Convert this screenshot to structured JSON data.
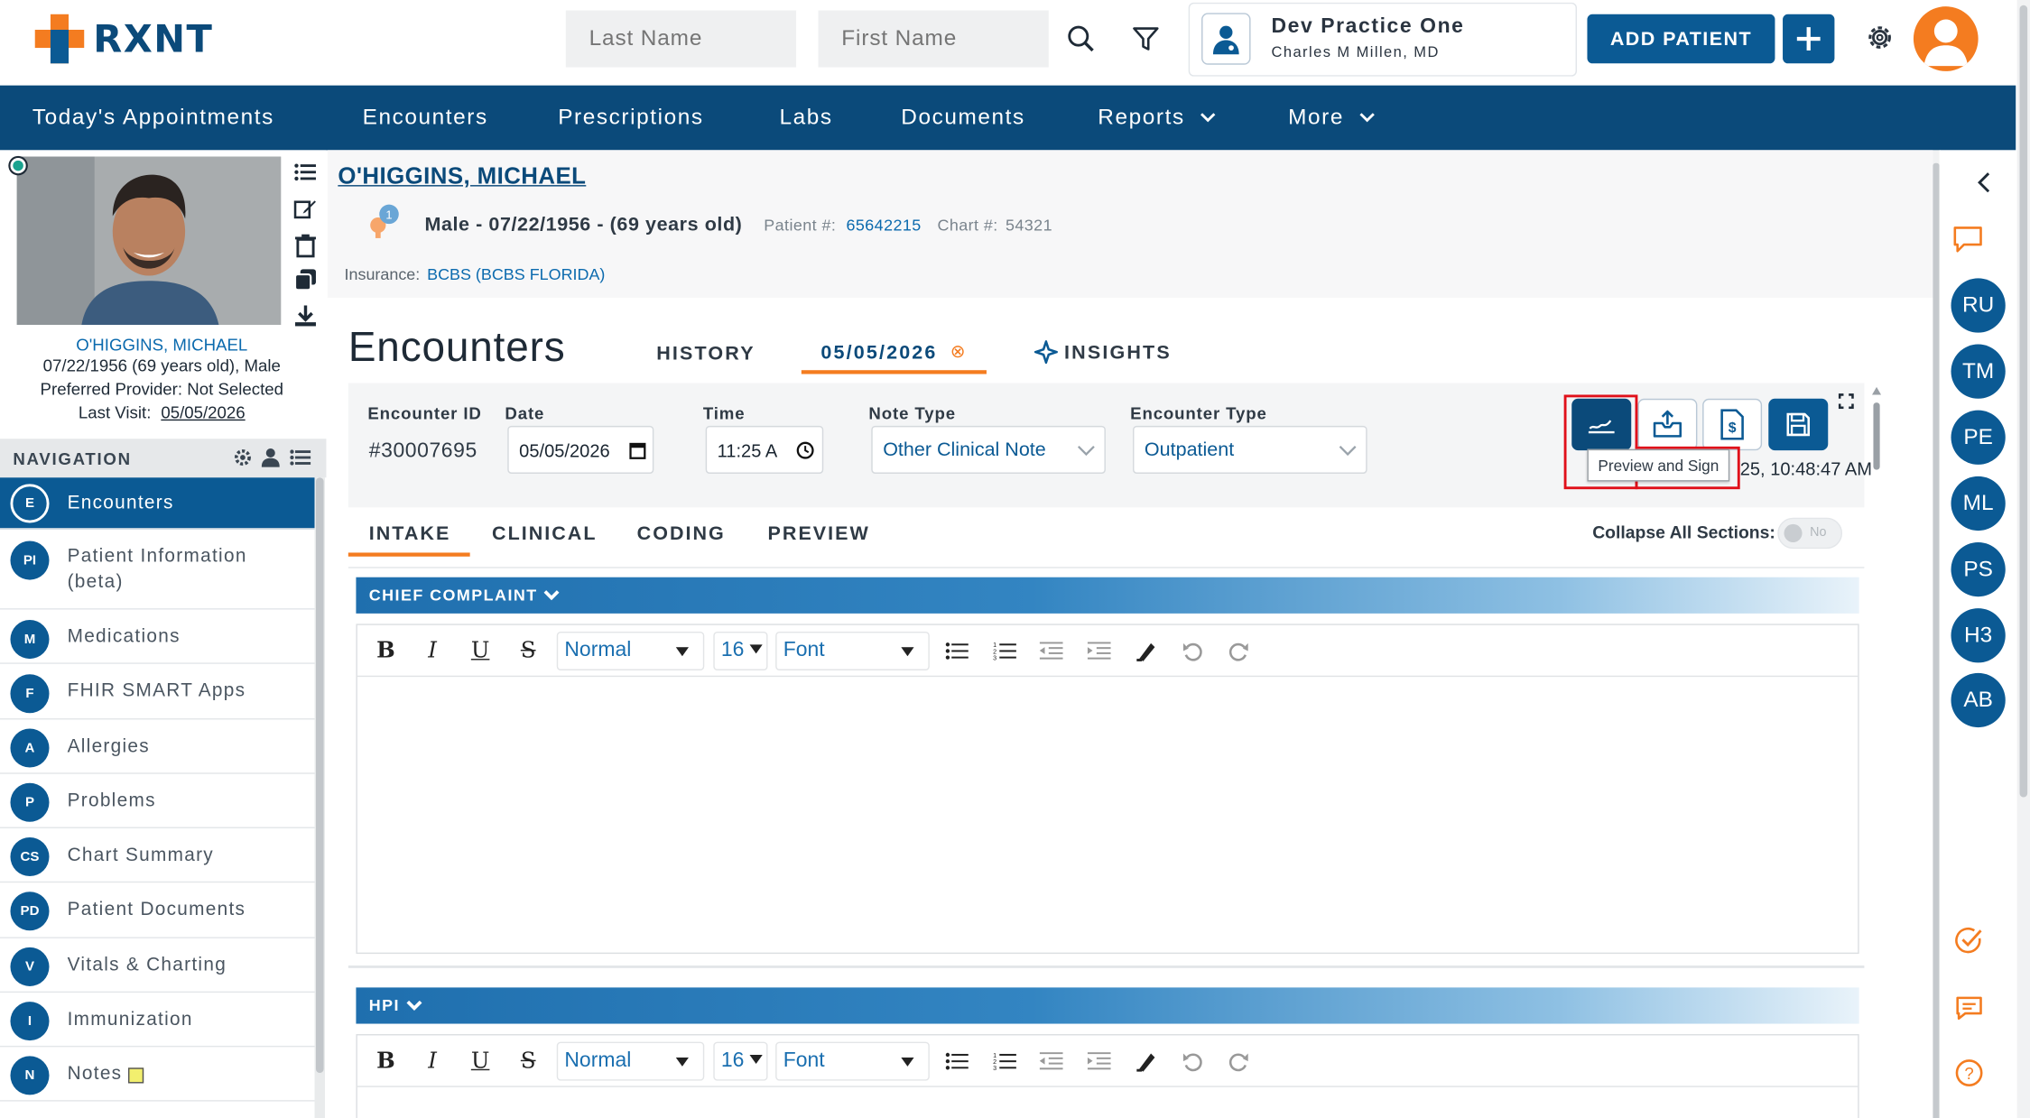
{
  "brand": {
    "logo_text": "RXNT",
    "brand_orange": "#f47c20",
    "brand_blue": "#0b5a94",
    "nav_blue": "#0b4a7a"
  },
  "search": {
    "last_name_placeholder": "Last Name",
    "first_name_placeholder": "First Name"
  },
  "practice": {
    "name": "Dev Practice One",
    "doctor": "Charles M Millen, MD"
  },
  "header_actions": {
    "add_patient": "ADD PATIENT"
  },
  "nav": {
    "items": [
      {
        "label": "Today's Appointments"
      },
      {
        "label": "Encounters"
      },
      {
        "label": "Prescriptions"
      },
      {
        "label": "Labs"
      },
      {
        "label": "Documents"
      },
      {
        "label": "Reports"
      },
      {
        "label": "More"
      }
    ]
  },
  "patient_card": {
    "name": "O'HIGGINS, MICHAEL",
    "dob_line": "07/22/1956 (69 years old), Male",
    "provider_line": "Preferred Provider: Not Selected",
    "last_visit_label": "Last Visit:",
    "last_visit_value": "05/05/2026"
  },
  "patient_header": {
    "name": "O'HIGGINS, MICHAEL",
    "alert_count": "1",
    "summary": "Male - 07/22/1956 - (69 years old)",
    "patient_num_label": "Patient #:",
    "patient_num": "65642215",
    "chart_num_label": "Chart #:",
    "chart_num": "54321",
    "insurance_label": "Insurance:",
    "insurance_value": "BCBS (BCBS FLORIDA)"
  },
  "navigation": {
    "title": "NAVIGATION",
    "items": [
      {
        "abbr": "E",
        "label": "Encounters",
        "active": true
      },
      {
        "abbr": "PI",
        "label": "Patient Information (beta)"
      },
      {
        "abbr": "M",
        "label": "Medications"
      },
      {
        "abbr": "F",
        "label": "FHIR SMART Apps"
      },
      {
        "abbr": "A",
        "label": "Allergies"
      },
      {
        "abbr": "P",
        "label": "Problems"
      },
      {
        "abbr": "CS",
        "label": "Chart Summary"
      },
      {
        "abbr": "PD",
        "label": "Patient Documents"
      },
      {
        "abbr": "V",
        "label": "Vitals & Charting"
      },
      {
        "abbr": "I",
        "label": "Immunization"
      },
      {
        "abbr": "N",
        "label": "Notes"
      }
    ]
  },
  "encounters": {
    "title": "Encounters",
    "tabs": [
      "HISTORY",
      "05/05/2026",
      "INSIGHTS"
    ],
    "close_symbol": "⊗",
    "fields": {
      "encounter_id_label": "Encounter ID",
      "encounter_id": "#30007695",
      "date_label": "Date",
      "date_value": "05/05/2026",
      "time_label": "Time",
      "time_value": "11:25 A",
      "note_type_label": "Note Type",
      "note_type_value": "Other Clinical Note",
      "encounter_type_label": "Encounter Type",
      "encounter_type_value": "Outpatient"
    },
    "tooltip": "Preview and Sign",
    "saved_time": "25, 10:48:47 AM",
    "subtabs": [
      "INTAKE",
      "CLINICAL",
      "CODING",
      "PREVIEW"
    ],
    "collapse_label": "Collapse All Sections:",
    "collapse_toggle": "No",
    "sections": [
      {
        "title": "CHIEF COMPLAINT"
      },
      {
        "title": "HPI"
      }
    ]
  },
  "editor_toolbar": {
    "bold": "B",
    "italic": "I",
    "underline": "U",
    "strike": "S",
    "format": "Normal",
    "size": "16",
    "font": "Font"
  },
  "right_rail": {
    "avatars": [
      "RU",
      "TM",
      "PE",
      "ML",
      "PS",
      "H3",
      "AB"
    ]
  }
}
